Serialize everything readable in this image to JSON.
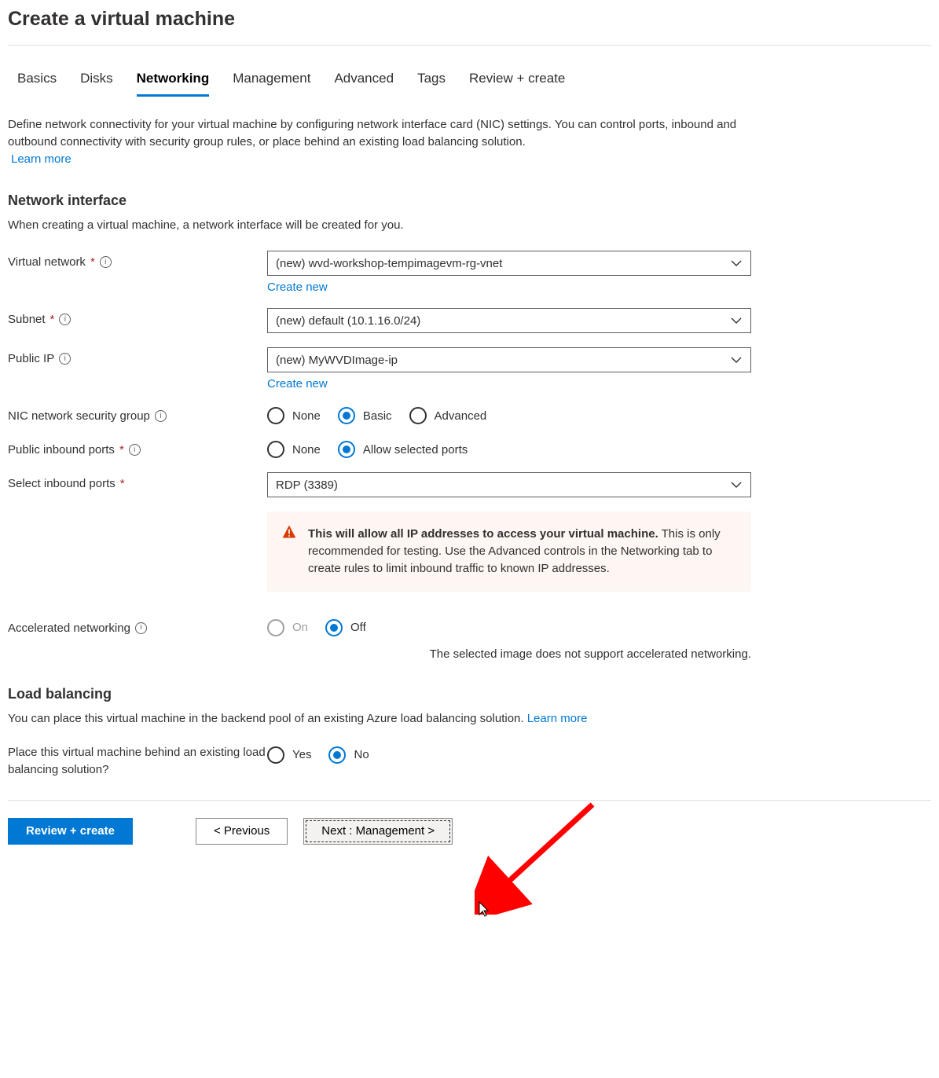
{
  "page_title": "Create a virtual machine",
  "tabs": {
    "items": [
      "Basics",
      "Disks",
      "Networking",
      "Management",
      "Advanced",
      "Tags",
      "Review + create"
    ],
    "active": "Networking"
  },
  "intro": {
    "text": "Define network connectivity for your virtual machine by configuring network interface card (NIC) settings. You can control ports, inbound and outbound connectivity with security group rules, or place behind an existing load balancing solution.",
    "learn_more": "Learn more"
  },
  "section_nic": {
    "title": "Network interface",
    "desc": "When creating a virtual machine, a network interface will be created for you."
  },
  "vnet": {
    "label": "Virtual network",
    "value": "(new) wvd-workshop-tempimagevm-rg-vnet",
    "create_new": "Create new"
  },
  "subnet": {
    "label": "Subnet",
    "value": "(new) default (10.1.16.0/24)"
  },
  "public_ip": {
    "label": "Public IP",
    "value": "(new) MyWVDImage-ip",
    "create_new": "Create new"
  },
  "nsg": {
    "label": "NIC network security group",
    "options": {
      "none": "None",
      "basic": "Basic",
      "advanced": "Advanced"
    }
  },
  "inbound_ports": {
    "label": "Public inbound ports",
    "options": {
      "none": "None",
      "allow": "Allow selected ports"
    }
  },
  "select_ports": {
    "label": "Select inbound ports",
    "value": "RDP (3389)"
  },
  "warning": {
    "bold": "This will allow all IP addresses to access your virtual machine.",
    "rest": " This is only recommended for testing.  Use the Advanced controls in the Networking tab to create rules to limit inbound traffic to known IP addresses."
  },
  "accel_net": {
    "label": "Accelerated networking",
    "options": {
      "on": "On",
      "off": "Off"
    },
    "helper": "The selected image does not support accelerated networking."
  },
  "load_balancing": {
    "title": "Load balancing",
    "desc": "You can place this virtual machine in the backend pool of an existing Azure load balancing solution.  ",
    "learn_more": "Learn more",
    "question": "Place this virtual machine behind an existing load balancing solution?",
    "options": {
      "yes": "Yes",
      "no": "No"
    }
  },
  "footer": {
    "review": "Review + create",
    "previous": "< Previous",
    "next": "Next : Management >"
  }
}
